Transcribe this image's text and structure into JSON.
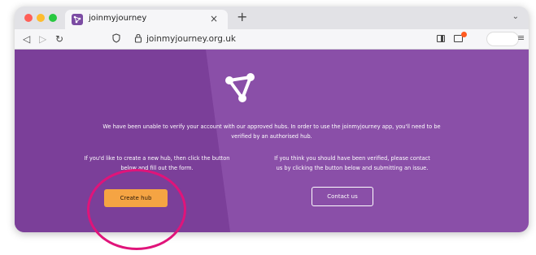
{
  "browser": {
    "tab_title": "joinmyjourney",
    "close_glyph": "×",
    "new_tab_glyph": "+",
    "tab_menu_glyph": "⌄",
    "url": "joinmyjourney.org.uk",
    "back_glyph": "◁",
    "forward_glyph": "▷",
    "reload_glyph": "↻",
    "menu_glyph": "≡",
    "icons": [
      "back-icon",
      "forward-icon",
      "reload-icon",
      "shield-icon",
      "lock-icon",
      "sidebar-icon",
      "extension-icon",
      "menu-icon"
    ]
  },
  "page": {
    "intro_line1": "We have been unable to verify your account with our approved hubs. In order to use the joinmyjourney app, you'll need to be",
    "intro_line2": "verified by an authorised hub.",
    "left_line1": "If you'd like to create a new hub, then click the button",
    "left_line2": "below and fill out the form.",
    "right_line1": "If you think you should have been verified, please contact",
    "right_line2": "us by clicking the button below and submitting an issue.",
    "create_button": "Create hub",
    "contact_button": "Contact us"
  },
  "colors": {
    "primary_purple": "#8a4fa8",
    "dark_purple": "#7b3f99",
    "button_orange": "#f5a443",
    "highlight_circle": "#e0147a"
  }
}
